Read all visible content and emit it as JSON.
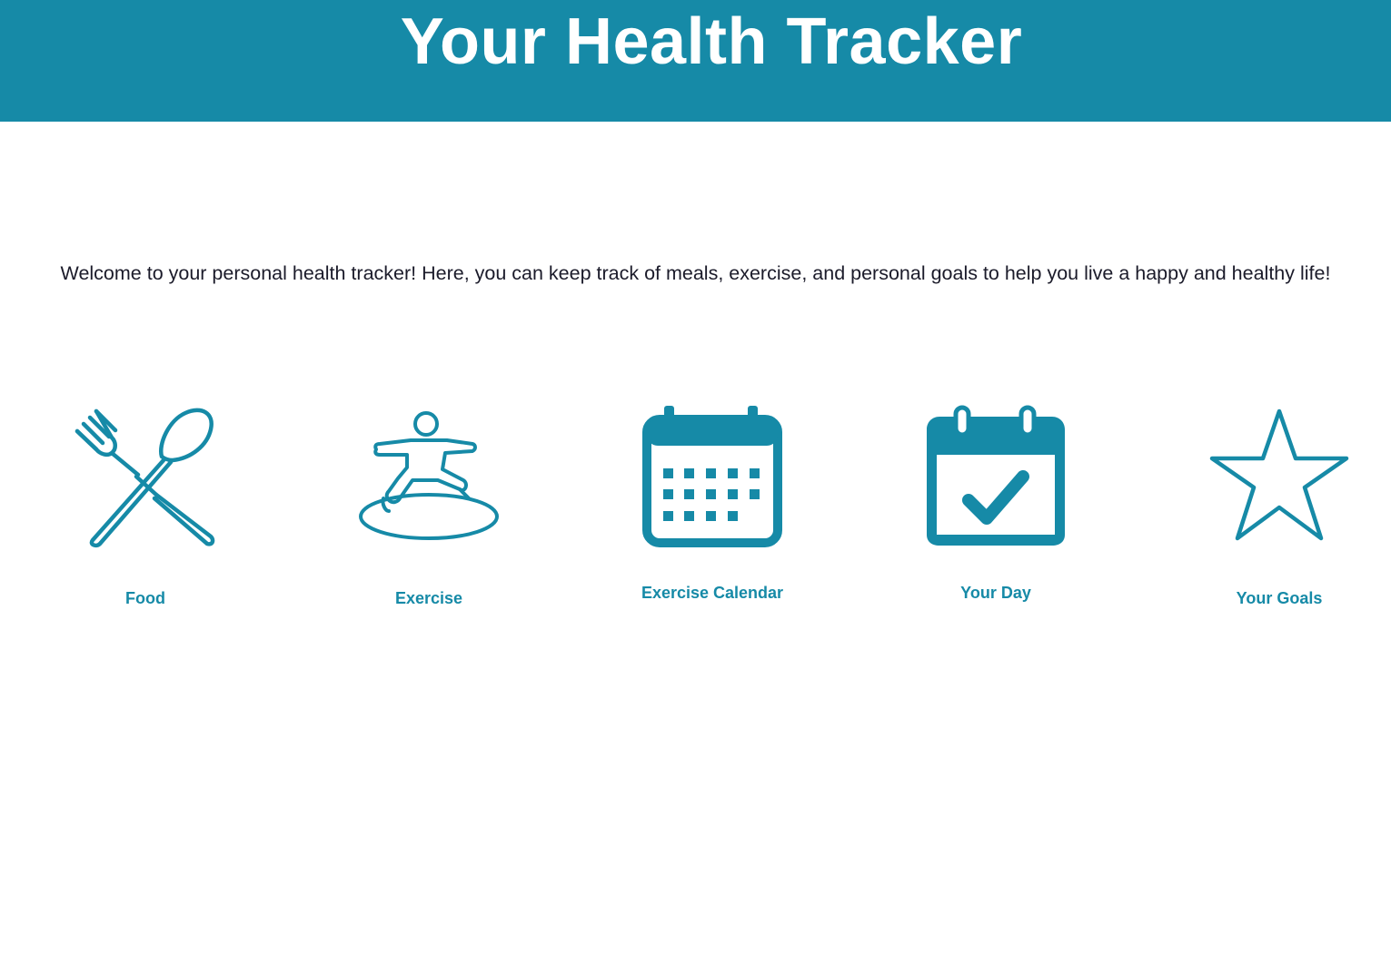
{
  "header": {
    "title": "Your Health Tracker"
  },
  "intro": {
    "text": "Welcome to your personal health tracker! Here, you can keep track of meals, exercise, and personal goals to help you live a happy and healthy life!"
  },
  "tiles": [
    {
      "label": "Food",
      "icon": "fork-spoon-icon"
    },
    {
      "label": "Exercise",
      "icon": "yoga-pose-icon"
    },
    {
      "label": "Exercise Calendar",
      "icon": "calendar-icon"
    },
    {
      "label": "Your Day",
      "icon": "calendar-check-icon"
    },
    {
      "label": "Your Goals",
      "icon": "star-icon"
    }
  ],
  "colors": {
    "brand": "#168aa7",
    "header_text": "#ffffff",
    "body_text": "#1b1b2a",
    "background": "#ffffff"
  }
}
